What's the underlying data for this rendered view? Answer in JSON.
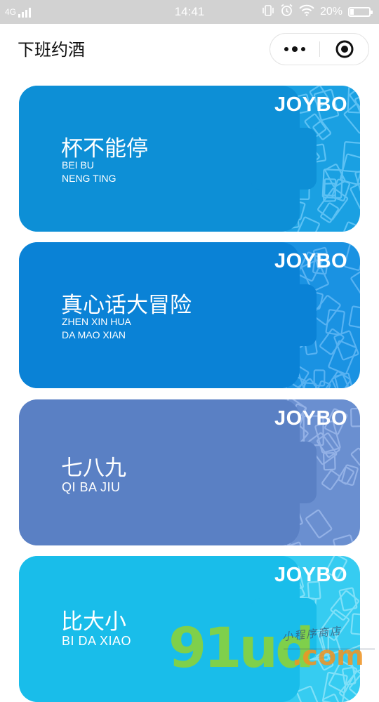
{
  "status_bar": {
    "network": "4G",
    "time": "14:41",
    "battery_percent": "20%",
    "battery_level": 0.2,
    "icons": [
      "signal-icon",
      "vibrate-icon",
      "alarm-icon",
      "wifi-icon",
      "battery-icon"
    ]
  },
  "nav": {
    "title": "下班约酒",
    "more_icon": "more-dots-icon",
    "close_icon": "target-close-icon"
  },
  "cards": [
    {
      "title": "杯不能停",
      "subtitle": "BEI BU\nNENG TING",
      "brand": "JOYBO",
      "color": "#0d8fd6",
      "bg": "#1aa0e2",
      "pattern": "#5cc1f4"
    },
    {
      "title": "真心话大冒险",
      "subtitle": "ZHEN XIN HUA\nDA MAO XIAN",
      "brand": "JOYBO",
      "color": "#0a82d6",
      "bg": "#1a92e2",
      "pattern": "#57b2f2"
    },
    {
      "title": "七八九",
      "subtitle": "QI BA JIU",
      "brand": "JOYBO",
      "color": "#5a80c4",
      "bg": "#6a8fd0",
      "pattern": "#93b1e6"
    },
    {
      "title": "比大小",
      "subtitle": "BI DA XIAO",
      "brand": "JOYBO",
      "color": "#19bdea",
      "bg": "#36ccf1",
      "pattern": "#7fe0f8"
    }
  ],
  "watermark": {
    "logo": "91ud",
    "domain": ".com",
    "tagline": "小程序商店"
  }
}
